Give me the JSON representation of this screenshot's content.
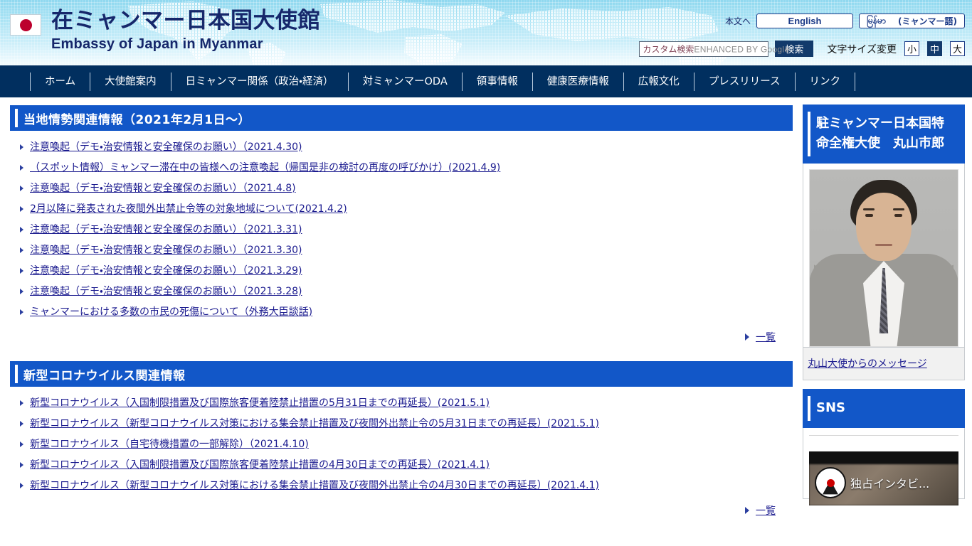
{
  "header": {
    "flag_icon": "japan-flag-icon",
    "title_ja": "在ミャンマー日本国大使館",
    "title_en": "Embassy of Japan in Myanmar",
    "skip_link": "本文へ",
    "lang_english": "English",
    "lang_myanmar_native": "မြန်မာ",
    "lang_myanmar_suffix": "(ミャンマー語)",
    "search": {
      "ghost_jp": "カスタム検索",
      "ghost_en": "ENHANCED BY Google",
      "value": "",
      "placeholder": "",
      "submit_label": "検索"
    },
    "fontsize": {
      "label": "文字サイズ変更",
      "small": "小",
      "medium": "中",
      "large": "大",
      "selected": "中"
    }
  },
  "gnav": {
    "items": [
      {
        "label": "ホーム"
      },
      {
        "label": "大使館案内"
      },
      {
        "label": "日ミャンマー関係（政治・経済）"
      },
      {
        "label": "対ミャンマーODA"
      },
      {
        "label": "領事情報"
      },
      {
        "label": "健康医療情報"
      },
      {
        "label": "広報文化"
      },
      {
        "label": "プレスリリース"
      },
      {
        "label": "リンク"
      }
    ]
  },
  "sections": [
    {
      "title": "当地情勢関連情報（2021年2月1日～）",
      "more_label": "一覧",
      "links": [
        {
          "label": "注意喚起（デモ・治安情報と安全確保のお願い）（2021.4.30)"
        },
        {
          "label": "（スポット情報）ミャンマー滞在中の皆様への注意喚起（帰国是非の検討の再度の呼びかけ）(2021.4.9)"
        },
        {
          "label": "注意喚起（デモ・治安情報と安全確保のお願い）（2021.4.8)"
        },
        {
          "label": "2月以降に発表された夜間外出禁止令等の対象地域について(2021.4.2)"
        },
        {
          "label": "注意喚起（デモ・治安情報と安全確保のお願い）（2021.3.31)"
        },
        {
          "label": "注意喚起（デモ・治安情報と安全確保のお願い）（2021.3.30)"
        },
        {
          "label": "注意喚起（デモ・治安情報と安全確保のお願い）（2021.3.29)"
        },
        {
          "label": "注意喚起（デモ・治安情報と安全確保のお願い）（2021.3.28)"
        },
        {
          "label": "ミャンマーにおける多数の市民の死傷について（外務大臣談話)"
        }
      ]
    },
    {
      "title": "新型コロナウイルス関連情報",
      "more_label": "一覧",
      "links": [
        {
          "label": "新型コロナウイルス（入国制限措置及び国際旅客便着陸禁止措置の5月31日までの再延長）(2021.5.1)"
        },
        {
          "label": "新型コロナウイルス（新型コロナウイルス対策における集会禁止措置及び夜間外出禁止令の5月31日までの再延長）(2021.5.1)"
        },
        {
          "label": "新型コロナウイルス（自宅待機措置の一部解除）（2021.4.10)"
        },
        {
          "label": "新型コロナウイルス（入国制限措置及び国際旅客便着陸禁止措置の4月30日までの再延長）(2021.4.1)"
        },
        {
          "label": "新型コロナウイルス（新型コロナウイルス対策における集会禁止措置及び夜間外出禁止令の4月30日までの再延長）(2021.4.1)"
        }
      ]
    }
  ],
  "sidebar": {
    "ambassador": {
      "title": "駐ミャンマー日本国特命全権大使　丸山市郎",
      "photo_name": "ambassador-portrait",
      "message_link": "丸山大使からのメッセージ"
    },
    "sns": {
      "title": "SNS",
      "video_caption": "独占インタビ...",
      "logo_name": "news-channel-logo"
    }
  },
  "colors": {
    "nav_bar": "#012f5f",
    "section_header": "#1257c8",
    "link_text": "#1b1b8f",
    "header_gradient_top": "#8fd8ef",
    "header_gradient_bottom": "#f1fbfe",
    "search_button": "#123a6b",
    "flag_red": "#bc002d"
  }
}
